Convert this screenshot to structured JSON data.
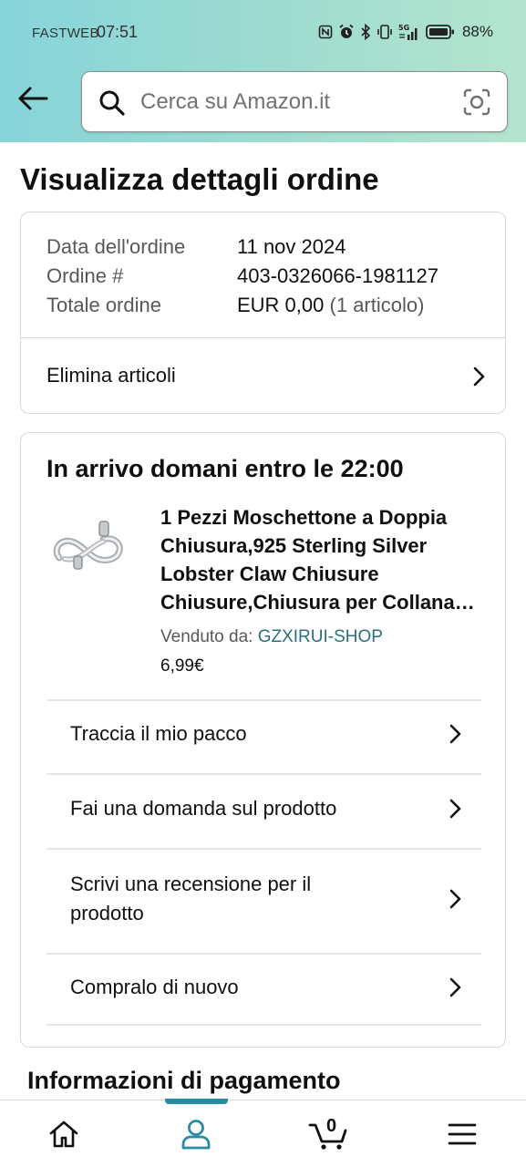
{
  "status_bar": {
    "carrier": "FASTWEB",
    "time": "07:51",
    "network": "5G",
    "battery_percent": "88%",
    "icons": [
      "nfc-icon",
      "alarm-icon",
      "bluetooth-icon",
      "vibrate-icon",
      "network-5g-icon",
      "signal-icon",
      "battery-icon"
    ]
  },
  "header": {
    "search_placeholder": "Cerca su Amazon.it",
    "icons": [
      "back-arrow-icon",
      "search-icon",
      "camera-scan-icon"
    ]
  },
  "page_title": "Visualizza dettagli ordine",
  "order_summary": {
    "rows": [
      {
        "label": "Data dell'ordine",
        "value": "11 nov 2024"
      },
      {
        "label": "Ordine #",
        "value": "403-0326066-1981127"
      },
      {
        "label": "Totale ordine",
        "value": "EUR 0,00",
        "value_note": "(1 articolo)"
      }
    ],
    "delete_items_label": "Elimina articoli"
  },
  "shipment": {
    "arrival": "In arrivo domani entro le 22:00",
    "product": {
      "title": "1 Pezzi Moschettone a Doppia Chiusura,925 Sterling Silver Lobster Claw Chiusure Chiusure,Chiusura per Collana Gioielli",
      "sold_by_label": "Venduto da:",
      "seller": "GZXIRUI-SHOP",
      "price": "6,99€"
    },
    "actions": [
      {
        "label": "Traccia il mio pacco"
      },
      {
        "label": "Fai una domanda sul prodotto"
      },
      {
        "label": "Scrivi una recensione per il prodotto"
      },
      {
        "label": "Compralo di nuovo"
      }
    ]
  },
  "payment_section_title": "Informazioni di pagamento",
  "bottom_nav": {
    "items": [
      "home-icon",
      "account-icon",
      "cart-icon",
      "menu-icon"
    ],
    "cart_count": "0",
    "active_item": "account-icon"
  },
  "colors": {
    "header_gradient_start": "#86d4da",
    "header_gradient_end": "#b4e4cf",
    "link": "#2a6f7a",
    "active_nav": "#2a8ca0",
    "text": "#0f1111",
    "muted_text": "#565959"
  }
}
